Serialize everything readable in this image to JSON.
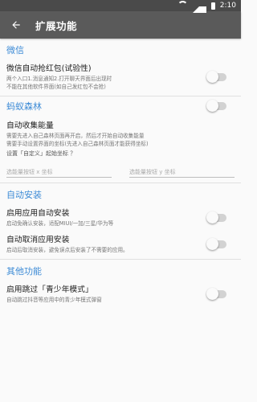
{
  "statusbar": {
    "time": "2:10"
  },
  "appbar": {
    "title": "扩展功能"
  },
  "wechat": {
    "header": "微信",
    "redpacket": {
      "title": "微信自动抢红包(试验性)",
      "desc1": "两个入口1.消息通知2.打开聊天界面后出现时",
      "desc2": "不能在其他软件界面(如自己发红包不会抢)"
    }
  },
  "ant": {
    "header": "蚂蚁森林",
    "collect": {
      "title": "自动收集能量",
      "desc1": "需要先进入自己森林页面再开启，然后才开始自动收集能量",
      "desc2": "需要手动设置界面的坐标(先进入自己森林页面才能获得坐标)",
      "note": "设置「自定义」起始坐标 ？"
    },
    "coord_x_placeholder": "选能量按钮 x 坐标",
    "coord_y_placeholder": "选能量按钮 y 坐标"
  },
  "install": {
    "header": "自动安装",
    "auto_install": {
      "title": "启用应用自动安装",
      "desc": "启动免确认安装，适配MIUI/一加/三星/华为等"
    },
    "auto_cancel": {
      "title": "自动取消应用安装",
      "desc": "启动后取消安装，避免误点后安装了不需要的应用。"
    },
    "footer_label": ""
  },
  "other": {
    "header": "其他功能",
    "teen_mode": {
      "title": "启用跳过「青少年模式」",
      "desc": "自动跳过抖音等应用中的青少年模式弹窗"
    }
  }
}
